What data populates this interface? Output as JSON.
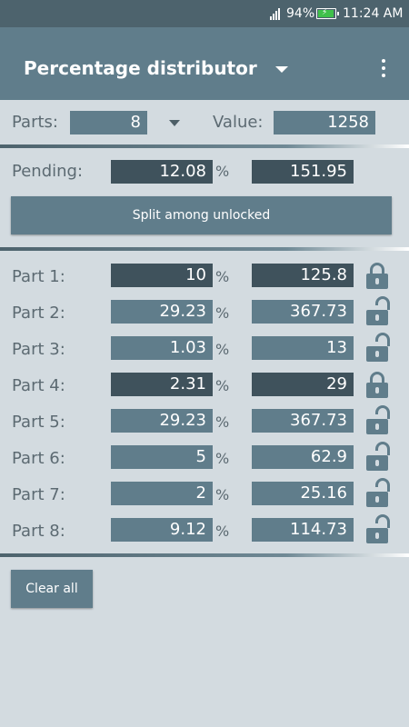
{
  "status_bar": {
    "battery_percent": "94%",
    "time": "11:24 AM"
  },
  "app_bar": {
    "title": "Percentage distributor"
  },
  "controls": {
    "parts_label": "Parts:",
    "parts_value": "8",
    "value_label": "Value:",
    "value": "1258"
  },
  "pending": {
    "label": "Pending:",
    "percent": "12.08",
    "percent_symbol": "%",
    "amount": "151.95"
  },
  "split_button": "Split among unlocked",
  "parts": [
    {
      "label": "Part 1:",
      "percent": "10",
      "percent_symbol": "%",
      "amount": "125.8",
      "locked": true
    },
    {
      "label": "Part 2:",
      "percent": "29.23",
      "percent_symbol": "%",
      "amount": "367.73",
      "locked": false
    },
    {
      "label": "Part 3:",
      "percent": "1.03",
      "percent_symbol": "%",
      "amount": "13",
      "locked": false
    },
    {
      "label": "Part 4:",
      "percent": "2.31",
      "percent_symbol": "%",
      "amount": "29",
      "locked": true
    },
    {
      "label": "Part 5:",
      "percent": "29.23",
      "percent_symbol": "%",
      "amount": "367.73",
      "locked": false
    },
    {
      "label": "Part 6:",
      "percent": "5",
      "percent_symbol": "%",
      "amount": "62.9",
      "locked": false
    },
    {
      "label": "Part 7:",
      "percent": "2",
      "percent_symbol": "%",
      "amount": "25.16",
      "locked": false
    },
    {
      "label": "Part 8:",
      "percent": "9.12",
      "percent_symbol": "%",
      "amount": "114.73",
      "locked": false
    }
  ],
  "clear_button": "Clear all",
  "colors": {
    "status_bar": "#4d636d",
    "app_bar": "#607d8b",
    "background": "#d3dbe0",
    "field": "#607d8b",
    "field_locked": "#3f525c",
    "battery": "#3fc04a"
  }
}
